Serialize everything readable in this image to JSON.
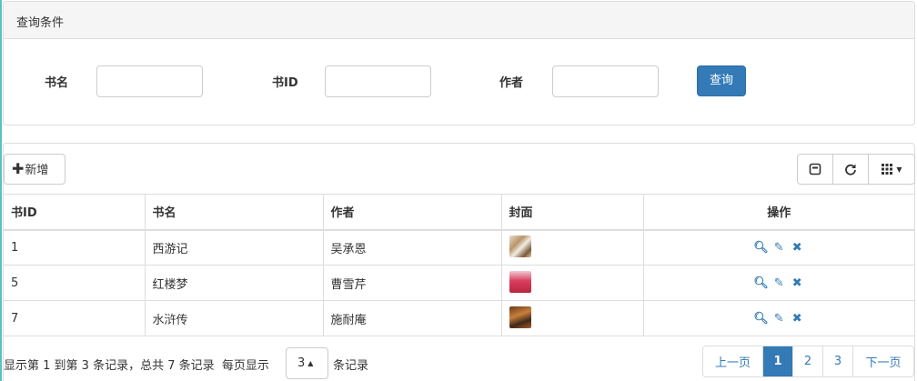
{
  "query": {
    "heading": "查询条件",
    "fields": [
      {
        "label": "书名",
        "value": ""
      },
      {
        "label": "书ID",
        "value": ""
      },
      {
        "label": "作者",
        "value": ""
      }
    ],
    "submit_label": "查询"
  },
  "toolbar": {
    "add_label": "新增",
    "tools": [
      "toggle-view-icon",
      "refresh-icon",
      "columns-icon"
    ]
  },
  "table": {
    "columns": [
      "书ID",
      "书名",
      "作者",
      "封面",
      "操作"
    ],
    "rows": [
      {
        "id": "1",
        "name": "西游记",
        "author": "吴承恩",
        "cover": "cover-thumbnail"
      },
      {
        "id": "5",
        "name": "红楼梦",
        "author": "曹雪芹",
        "cover": "cover-thumbnail"
      },
      {
        "id": "7",
        "name": "水浒传",
        "author": "施耐庵",
        "cover": "cover-thumbnail"
      }
    ],
    "row_actions": [
      "view-icon",
      "edit-icon",
      "delete-icon"
    ]
  },
  "pagination": {
    "info": "显示第 1 到第 3 条记录，总共 7 条记录",
    "page_size_prefix": "每页显示",
    "page_size": "3",
    "page_size_suffix": "条记录",
    "prev_label": "上一页",
    "pages": [
      "1",
      "2",
      "3"
    ],
    "current_page": "1",
    "next_label": "下一页"
  },
  "colors": {
    "primary": "#337ab7",
    "border": "#dddddd",
    "heading_bg": "#f5f5f5"
  }
}
